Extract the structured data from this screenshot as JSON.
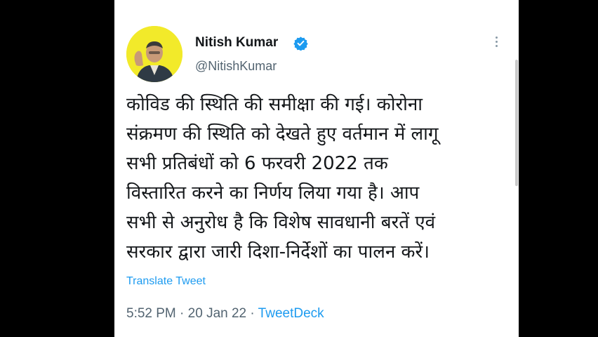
{
  "author": {
    "display_name": "Nitish Kumar",
    "handle": "@NitishKumar",
    "verified": true
  },
  "tweet": {
    "text_lines": [
      "कोविड की स्थिति की समीक्षा की गई। कोरोना",
      "संक्रमण की स्थिति को देखते हुए वर्तमान में लागू",
      "सभी प्रतिबंधों को 6 फरवरी 2022 तक",
      "विस्तारित करने का निर्णय लिया गया है। आप",
      "सभी से अनुरोध है कि विशेष सावधानी बरतें एवं",
      "सरकार द्वारा जारी दिशा-निर्देशों का पालन करें।"
    ],
    "translate_label": "Translate Tweet",
    "time": "5:52 PM",
    "date": "20 Jan 22",
    "separator": "·",
    "source": "TweetDeck"
  },
  "colors": {
    "link": "#1d9bf0",
    "avatar_bg": "#f2ea2a",
    "verified": "#1d9bf0"
  },
  "icons": {
    "verified": "verified-badge-icon",
    "more": "more-options-icon"
  }
}
